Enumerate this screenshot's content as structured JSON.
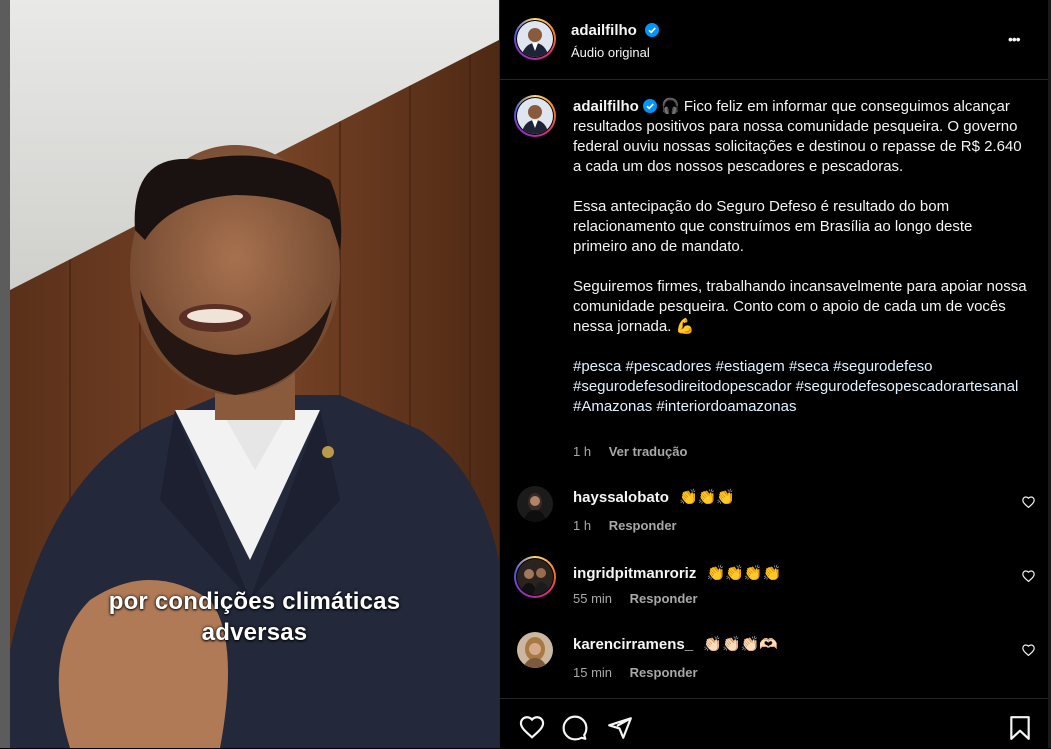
{
  "video": {
    "caption_line1": "por condições climáticas",
    "caption_line2": "adversas"
  },
  "post": {
    "username": "adailfilho",
    "audio": "Áudio original",
    "more_label": "•••",
    "caption_paragraphs": [
      "Fico feliz em informar que conseguimos alcançar resultados positivos para nossa comunidade pesqueira. O governo federal ouviu nossas solicitações e destinou o repasse de R$ 2.640 a cada um dos nossos pescadores e pescadoras.",
      "Essa antecipação do Seguro Defeso é resultado do bom relacionamento que construímos em Brasília ao longo deste primeiro ano de mandato.",
      "Seguiremos firmes, trabalhando incansavelmente para apoiar nossa comunidade pesqueira. Conto com o apoio de cada um de vocês nessa jornada. 💪"
    ],
    "caption_emoji": "🎧",
    "hashtags": "#pesca #pescadores #estiagem #seca #segurodefeso #segurodefesodireitodopescador #segurodefesopescadorartesanal #Amazonas #interiordoamazonas",
    "time": "1 h",
    "translate_label": "Ver tradução"
  },
  "comments": [
    {
      "username": "hayssalobato",
      "text": "👏👏👏",
      "time": "1 h",
      "reply_label": "Responder"
    },
    {
      "username": "ingridpitmanroriz",
      "text": "👏👏👏👏",
      "time": "55 min",
      "reply_label": "Responder"
    },
    {
      "username": "karencirramens_",
      "text": "👏🏻👏🏻👏🏻🫶🏻",
      "time": "15 min",
      "reply_label": "Responder"
    }
  ],
  "colors": {
    "verified": "#0095f6",
    "caption_highlight": "#7b3fe4",
    "background": "#000000"
  }
}
